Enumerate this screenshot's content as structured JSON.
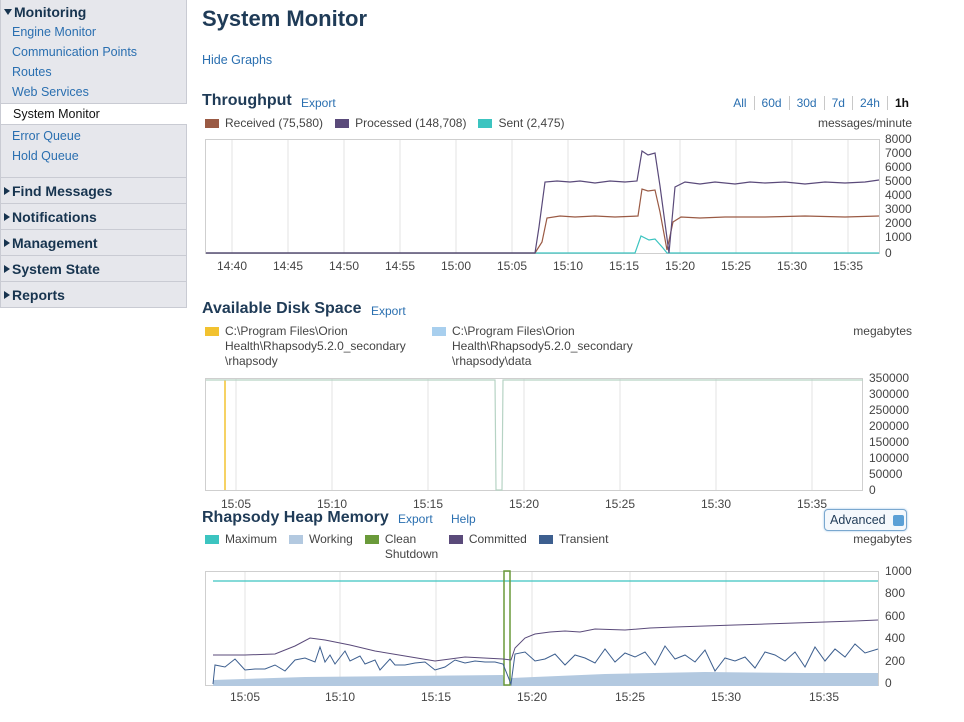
{
  "sidebar": {
    "monitoring": {
      "label": "Monitoring",
      "items": [
        "Engine Monitor",
        "Communication Points",
        "Routes",
        "Web Services",
        "System Monitor",
        "Error Queue",
        "Hold Queue"
      ]
    },
    "groups": [
      "Find Messages",
      "Notifications",
      "Management",
      "System State",
      "Reports"
    ]
  },
  "page": {
    "title": "System Monitor",
    "hide_graphs": "Hide Graphs"
  },
  "throughput": {
    "title": "Throughput",
    "export": "Export",
    "units": "messages/minute",
    "ranges": [
      "All",
      "60d",
      "30d",
      "7d",
      "24h",
      "1h"
    ],
    "legend": [
      {
        "label": "Received (75,580)",
        "color": "#9a5a44"
      },
      {
        "label": "Processed (148,708)",
        "color": "#5a4a7a"
      },
      {
        "label": "Sent (2,475)",
        "color": "#3cc4c0"
      }
    ],
    "y_ticks": [
      "8000",
      "7000",
      "6000",
      "5000",
      "4000",
      "3000",
      "2000",
      "1000",
      "0"
    ],
    "x_ticks": [
      "14:40",
      "14:45",
      "14:50",
      "14:55",
      "15:00",
      "15:05",
      "15:10",
      "15:15",
      "15:20",
      "15:25",
      "15:30",
      "15:35"
    ]
  },
  "disk": {
    "title": "Available Disk Space",
    "export": "Export",
    "units": "megabytes",
    "legend": [
      {
        "label": "C:\\Program Files\\Orion Health\\Rhapsody5.2.0_secondary \\rhapsody",
        "color": "#f2c230"
      },
      {
        "label": "C:\\Program Files\\Orion Health\\Rhapsody5.2.0_secondary \\rhapsody\\data",
        "color": "#a8cfee"
      }
    ],
    "y_ticks": [
      "350000",
      "300000",
      "250000",
      "200000",
      "150000",
      "100000",
      "50000",
      "0"
    ],
    "x_ticks": [
      "15:05",
      "15:10",
      "15:15",
      "15:20",
      "15:25",
      "15:30",
      "15:35"
    ]
  },
  "heap": {
    "title": "Rhapsody Heap Memory",
    "export": "Export",
    "help": "Help",
    "advanced": "Advanced",
    "units": "megabytes",
    "legend": [
      {
        "label": "Maximum",
        "color": "#3cc4c0"
      },
      {
        "label": "Working",
        "color": "#b3c9e0"
      },
      {
        "label": "Clean Shutdown",
        "color": "#6a9a3a"
      },
      {
        "label": "Committed",
        "color": "#5a4a7a"
      },
      {
        "label": "Transient",
        "color": "#3d5f8f"
      }
    ],
    "y_ticks": [
      "1000",
      "800",
      "600",
      "400",
      "200",
      "0"
    ],
    "x_ticks": [
      "15:05",
      "15:10",
      "15:15",
      "15:20",
      "15:25",
      "15:30",
      "15:35"
    ]
  }
}
